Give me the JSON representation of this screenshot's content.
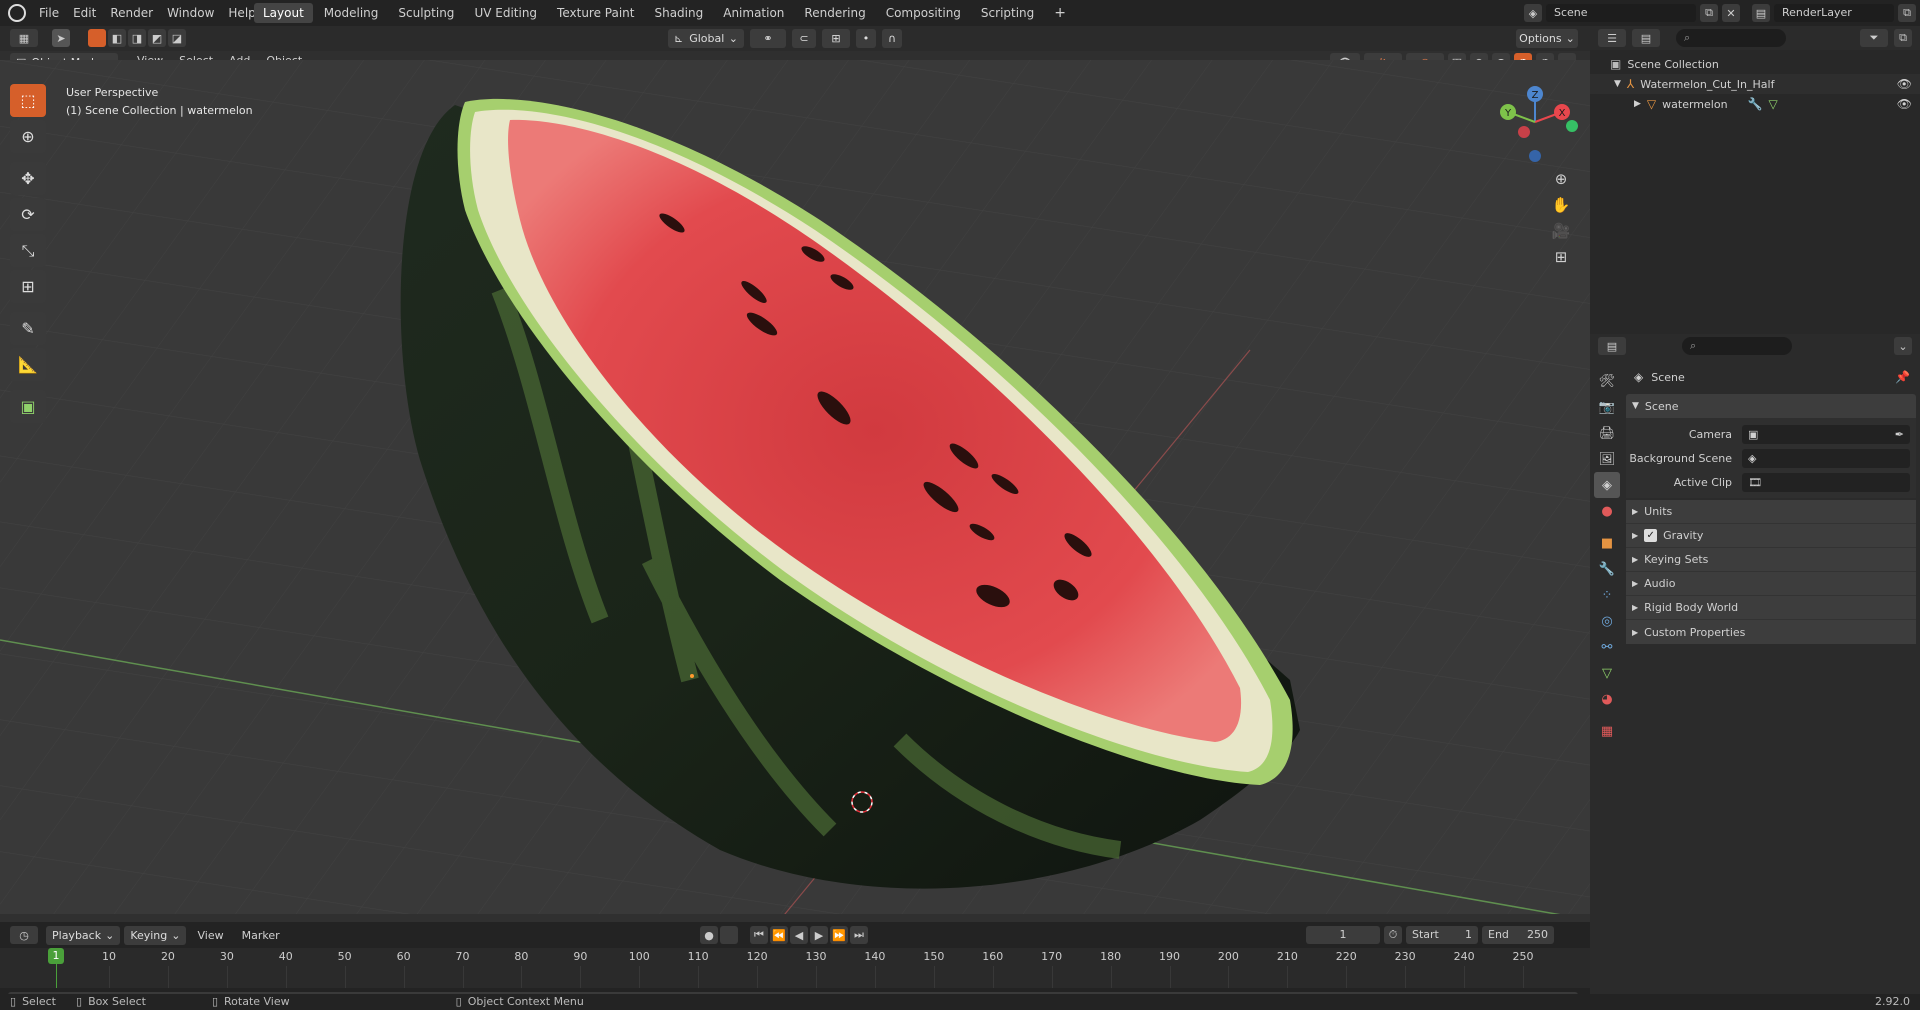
{
  "menu": {
    "items": [
      "File",
      "Edit",
      "Render",
      "Window",
      "Help"
    ]
  },
  "workspaces": {
    "tabs": [
      "Layout",
      "Modeling",
      "Sculpting",
      "UV Editing",
      "Texture Paint",
      "Shading",
      "Animation",
      "Rendering",
      "Compositing",
      "Scripting"
    ],
    "active": "Layout",
    "add_label": "+"
  },
  "top_right": {
    "scene": "Scene",
    "render_layer": "RenderLayer"
  },
  "header": {
    "transform_orientation": "Global",
    "options": "Options"
  },
  "viewport_header": {
    "mode": "Object Mode",
    "menus": [
      "View",
      "Select",
      "Add",
      "Object"
    ]
  },
  "viewport": {
    "perspective": "User Perspective",
    "collection_info": "(1) Scene Collection | watermelon"
  },
  "gizmo": {
    "x": "X",
    "y": "Y",
    "z": "Z"
  },
  "outliner": {
    "items": [
      {
        "label": "Scene Collection",
        "icon": "collection-icon"
      },
      {
        "label": "Watermelon_Cut_In_Half",
        "icon": "empty-axes-icon"
      },
      {
        "label": "watermelon",
        "icon": "mesh-icon"
      }
    ]
  },
  "properties": {
    "context": "Scene",
    "panel": "Scene",
    "fields": [
      {
        "label": "Camera",
        "value": ""
      },
      {
        "label": "Background Scene",
        "value": ""
      },
      {
        "label": "Active Clip",
        "value": ""
      }
    ],
    "subpanels": [
      "Units",
      "Gravity",
      "Keying Sets",
      "Audio",
      "Rigid Body World",
      "Custom Properties"
    ],
    "gravity_checked": true
  },
  "timeline": {
    "menus": [
      "Playback",
      "Keying",
      "View",
      "Marker"
    ],
    "current_frame": "1",
    "start_label": "Start",
    "start": "1",
    "end_label": "End",
    "end": "250",
    "ticks": [
      "1",
      "10",
      "20",
      "30",
      "40",
      "50",
      "60",
      "70",
      "80",
      "90",
      "100",
      "110",
      "120",
      "130",
      "140",
      "150",
      "160",
      "170",
      "180",
      "190",
      "200",
      "210",
      "220",
      "230",
      "240",
      "250"
    ]
  },
  "statusbar": {
    "select": "Select",
    "box_select": "Box Select",
    "rotate_view": "Rotate View",
    "context_menu": "Object Context Menu",
    "version": "2.92.0"
  },
  "colors": {
    "accent": "#d65f2a",
    "active_tab": "#444444",
    "x_axis": "#e8474d",
    "y_axis": "#7ec24a",
    "z_axis": "#4d86cf"
  }
}
